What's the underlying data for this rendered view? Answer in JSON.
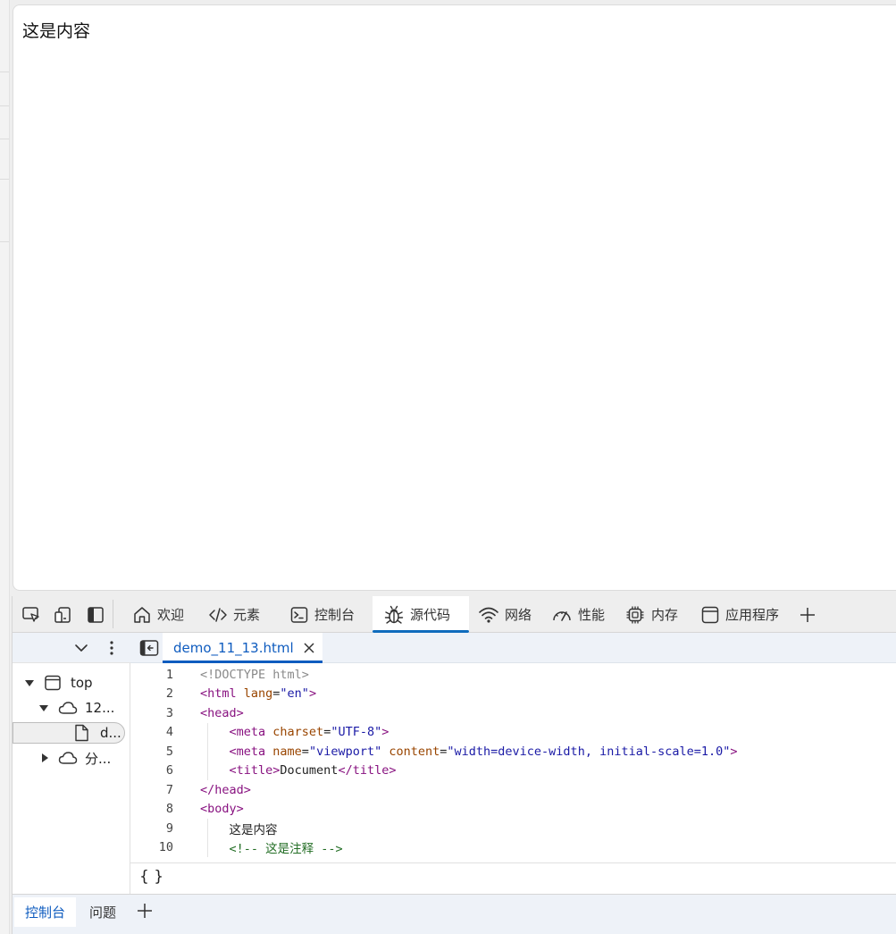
{
  "viewport": {
    "content_text": "这是内容"
  },
  "toolbar": {
    "tabs": [
      {
        "label": "欢迎",
        "icon": "home-icon"
      },
      {
        "label": "元素",
        "icon": "code-brackets-icon"
      },
      {
        "label": "控制台",
        "icon": "terminal-icon"
      },
      {
        "label": "源代码",
        "icon": "bug-icon",
        "active": true
      },
      {
        "label": "网络",
        "icon": "wifi-icon"
      },
      {
        "label": "性能",
        "icon": "gauge-icon"
      },
      {
        "label": "内存",
        "icon": "chip-icon"
      },
      {
        "label": "应用程序",
        "icon": "app-window-icon"
      }
    ],
    "add_tab": "+"
  },
  "navigator": {
    "tree": [
      {
        "label": "top",
        "icon": "window-icon",
        "expanded": true
      },
      {
        "label": "12...",
        "icon": "cloud-icon",
        "expanded": true
      },
      {
        "label": "d...",
        "icon": "file-icon",
        "selected": true
      },
      {
        "label": "分...",
        "icon": "cloud-icon",
        "expanded": false
      }
    ]
  },
  "editor": {
    "file_tab": "demo_11_13.html",
    "lines": [
      {
        "n": "1",
        "parts": [
          {
            "t": "<!DOCTYPE html>",
            "c": "gray"
          }
        ]
      },
      {
        "n": "2",
        "parts": [
          {
            "t": "<html",
            "c": "tag"
          },
          {
            "t": " lang",
            "c": "attr"
          },
          {
            "t": "=",
            "c": "text"
          },
          {
            "t": "\"en\"",
            "c": "val"
          },
          {
            "t": ">",
            "c": "tag"
          }
        ]
      },
      {
        "n": "3",
        "parts": [
          {
            "t": "<head>",
            "c": "tag"
          }
        ]
      },
      {
        "n": "4",
        "parts": [
          {
            "t": "    <meta",
            "c": "tag"
          },
          {
            "t": " charset",
            "c": "attr"
          },
          {
            "t": "=",
            "c": "text"
          },
          {
            "t": "\"UTF-8\"",
            "c": "val"
          },
          {
            "t": ">",
            "c": "tag"
          }
        ]
      },
      {
        "n": "5",
        "parts": [
          {
            "t": "    <meta",
            "c": "tag"
          },
          {
            "t": " name",
            "c": "attr"
          },
          {
            "t": "=",
            "c": "text"
          },
          {
            "t": "\"viewport\"",
            "c": "val"
          },
          {
            "t": " content",
            "c": "attr"
          },
          {
            "t": "=",
            "c": "text"
          },
          {
            "t": "\"width=device-width, initial-scale=1.0\"",
            "c": "val"
          },
          {
            "t": ">",
            "c": "tag"
          }
        ]
      },
      {
        "n": "6",
        "parts": [
          {
            "t": "    <title>",
            "c": "tag"
          },
          {
            "t": "Document",
            "c": "text"
          },
          {
            "t": "</title>",
            "c": "tag"
          }
        ]
      },
      {
        "n": "7",
        "parts": [
          {
            "t": "</head>",
            "c": "tag"
          }
        ]
      },
      {
        "n": "8",
        "parts": [
          {
            "t": "<body>",
            "c": "tag"
          }
        ]
      },
      {
        "n": "9",
        "parts": [
          {
            "t": "    这是内容",
            "c": "text"
          }
        ]
      },
      {
        "n": "10",
        "parts": [
          {
            "t": "    <!-- 这是注释 -->",
            "c": "comment"
          }
        ]
      }
    ],
    "pretty_print_label": "{ }"
  },
  "drawer": {
    "tabs": [
      {
        "label": "控制台",
        "active": true
      },
      {
        "label": "问题",
        "active": false
      }
    ],
    "add_tab": "+"
  },
  "colors": {
    "accent": "#0f6cbd",
    "tag": "#881280",
    "attr": "#994500",
    "value": "#1a1aa6",
    "comment": "#236e25"
  }
}
